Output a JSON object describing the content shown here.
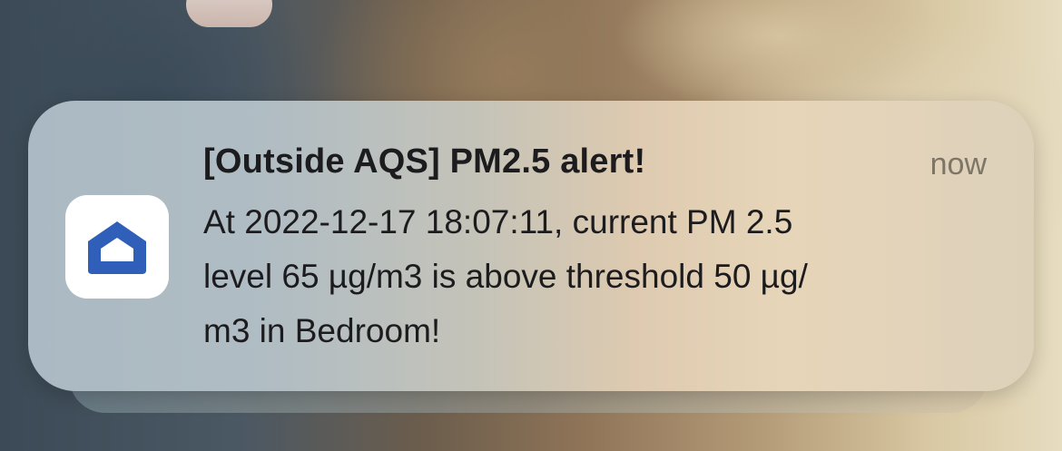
{
  "notification": {
    "title": "[Outside AQS] PM2.5 alert!",
    "time": "now",
    "body_lines": [
      "At 2022-12-17 18:07:11, current PM 2.5",
      "level 65 µg/m3 is above threshold 50 µg/",
      "m3 in Bedroom!"
    ],
    "app_icon": "home-icon",
    "icon_color": "#2f5fb8"
  }
}
